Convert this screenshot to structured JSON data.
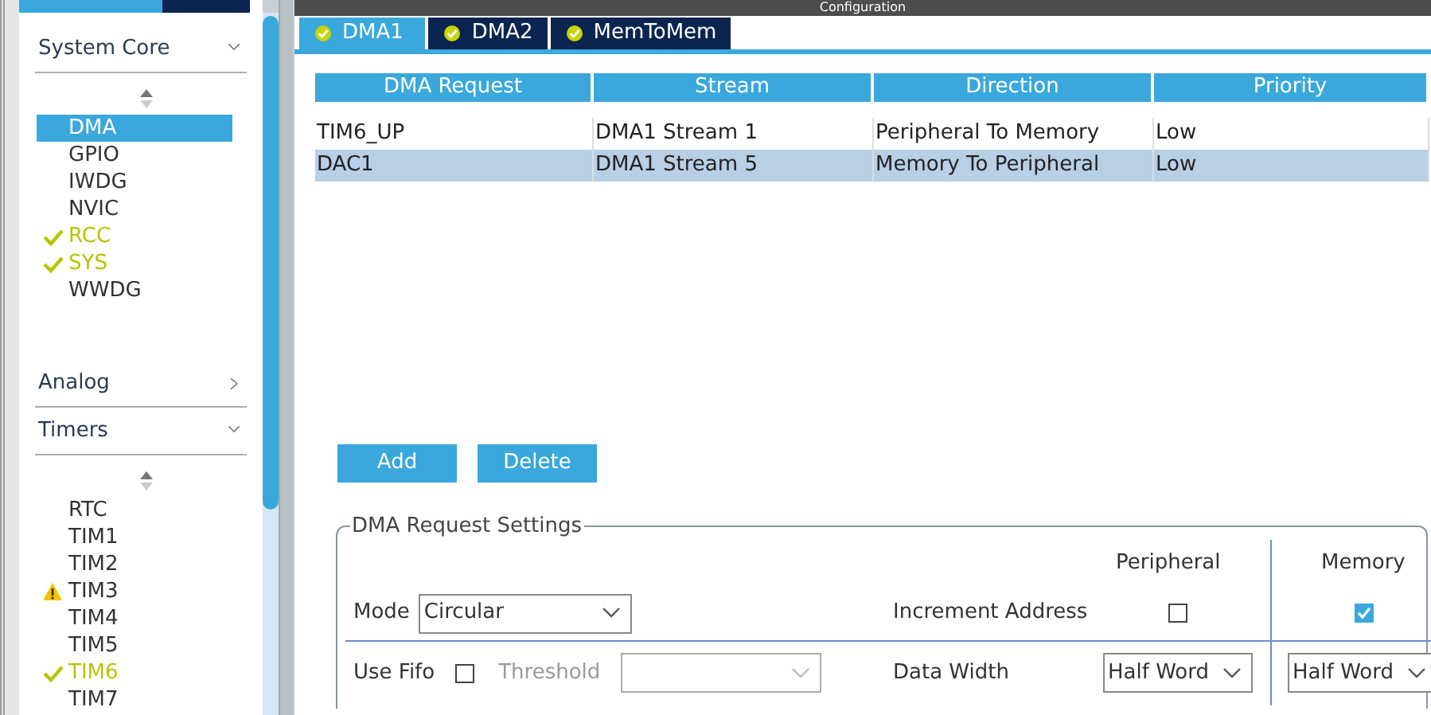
{
  "sidebar": {
    "sections": [
      {
        "title": "System Core",
        "expanded": true,
        "items": [
          {
            "label": "DMA",
            "selected": true,
            "configured": false,
            "warning": false
          },
          {
            "label": "GPIO",
            "selected": false,
            "configured": false,
            "warning": false
          },
          {
            "label": "IWDG",
            "selected": false,
            "configured": false,
            "warning": false
          },
          {
            "label": "NVIC",
            "selected": false,
            "configured": false,
            "warning": false
          },
          {
            "label": "RCC",
            "selected": false,
            "configured": true,
            "warning": false
          },
          {
            "label": "SYS",
            "selected": false,
            "configured": true,
            "warning": false
          },
          {
            "label": "WWDG",
            "selected": false,
            "configured": false,
            "warning": false
          }
        ]
      },
      {
        "title": "Analog",
        "expanded": false
      },
      {
        "title": "Timers",
        "expanded": true,
        "items": [
          {
            "label": "RTC",
            "selected": false,
            "configured": false,
            "warning": false
          },
          {
            "label": "TIM1",
            "selected": false,
            "configured": false,
            "warning": false
          },
          {
            "label": "TIM2",
            "selected": false,
            "configured": false,
            "warning": false
          },
          {
            "label": "TIM3",
            "selected": false,
            "configured": false,
            "warning": true
          },
          {
            "label": "TIM4",
            "selected": false,
            "configured": false,
            "warning": false
          },
          {
            "label": "TIM5",
            "selected": false,
            "configured": false,
            "warning": false
          },
          {
            "label": "TIM6",
            "selected": false,
            "configured": true,
            "warning": false
          },
          {
            "label": "TIM7",
            "selected": false,
            "configured": false,
            "warning": false
          }
        ]
      }
    ]
  },
  "config": {
    "title": "Configuration",
    "tabs": [
      {
        "label": "DMA1",
        "selected": true
      },
      {
        "label": "DMA2",
        "selected": false
      },
      {
        "label": "MemToMem",
        "selected": false
      }
    ],
    "table": {
      "columns": [
        "DMA Request",
        "Stream",
        "Direction",
        "Priority"
      ],
      "rows": [
        {
          "cells": [
            "TIM6_UP",
            "DMA1 Stream 1",
            "Peripheral To Memory",
            "Low"
          ],
          "selected": false
        },
        {
          "cells": [
            "DAC1",
            "DMA1 Stream 5",
            "Memory To Peripheral",
            "Low"
          ],
          "selected": true
        }
      ]
    },
    "buttons": [
      "Add",
      "Delete"
    ],
    "settings": {
      "legend": "DMA Request Settings",
      "peripheral_heading": "Peripheral",
      "memory_heading": "Memory",
      "mode_label": "Mode",
      "mode_value": "Circular",
      "increment_label": "Increment Address",
      "peripheral_increment": false,
      "memory_increment": true,
      "fifo_label": "Use Fifo",
      "use_fifo": false,
      "threshold_label": "Threshold",
      "threshold_disabled": true,
      "data_width_label": "Data Width",
      "peripheral_width": "Half Word",
      "memory_width": "Half Word"
    }
  }
}
